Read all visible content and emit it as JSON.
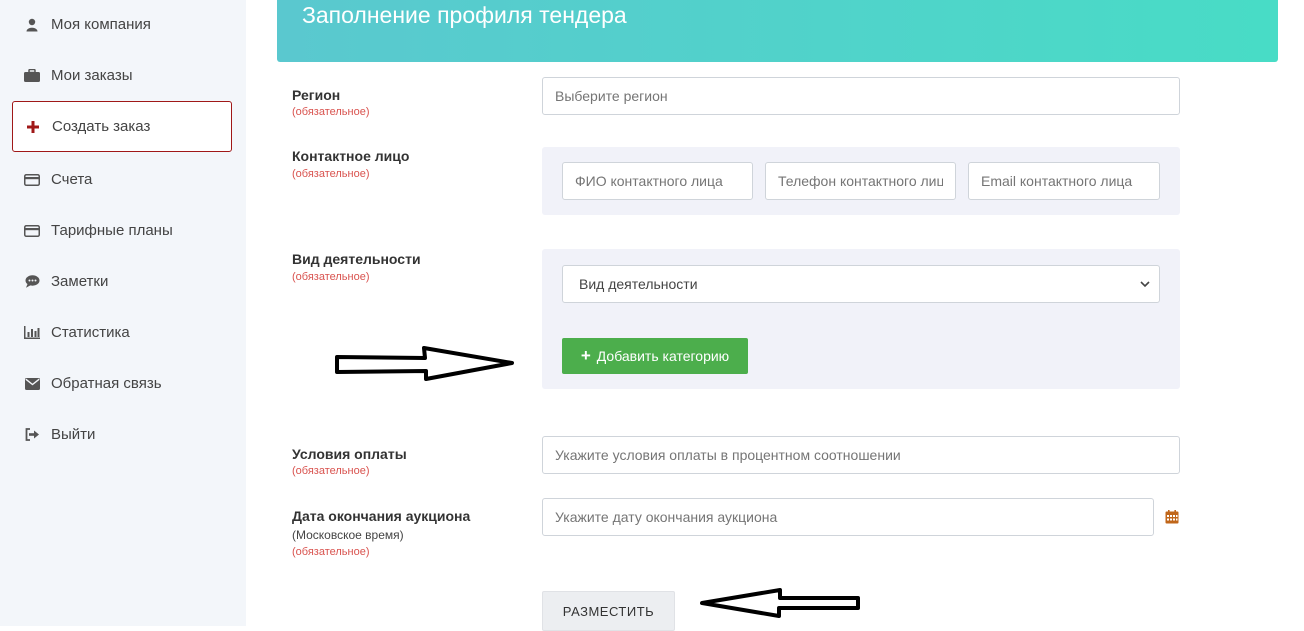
{
  "sidebar": {
    "items": [
      {
        "label": "Моя компания",
        "icon": "user-icon"
      },
      {
        "label": "Мои заказы",
        "icon": "briefcase-icon"
      },
      {
        "label": "Создать заказ",
        "icon": "plus-icon",
        "active": true
      },
      {
        "label": "Счета",
        "icon": "credit-card-icon"
      },
      {
        "label": "Тарифные планы",
        "icon": "credit-card-icon"
      },
      {
        "label": "Заметки",
        "icon": "comment-icon"
      },
      {
        "label": "Статистика",
        "icon": "bar-chart-icon"
      },
      {
        "label": "Обратная связь",
        "icon": "envelope-icon"
      },
      {
        "label": "Выйти",
        "icon": "sign-out-icon"
      }
    ]
  },
  "header": {
    "title": "Заполнение профиля тендера"
  },
  "form": {
    "required_note": "(обязательное)",
    "region": {
      "label": "Регион",
      "placeholder": "Выберите регион"
    },
    "contact": {
      "label": "Контактное лицо",
      "name_placeholder": "ФИО контактного лица",
      "phone_placeholder": "Телефон контактного лица",
      "email_placeholder": "Email контактного лица"
    },
    "activity": {
      "label": "Вид деятельности",
      "select_value": "Вид деятельности",
      "add_button": "Добавить категорию"
    },
    "payment": {
      "label": "Условия оплаты",
      "placeholder": "Укажите условия оплаты в процентном соотношении"
    },
    "auction_end": {
      "label": "Дата окончания аукциона",
      "sublabel": "(Московское время)",
      "placeholder": "Укажите дату окончания аукциона"
    },
    "submit_label": "РАЗМЕСТИТЬ"
  },
  "colors": {
    "header_start": "#5ac8cf",
    "header_end": "#48dcc6",
    "active_border": "#a01818",
    "required": "#d9534f",
    "green_button": "#4cae4c",
    "calendar_icon": "#c0661a"
  }
}
